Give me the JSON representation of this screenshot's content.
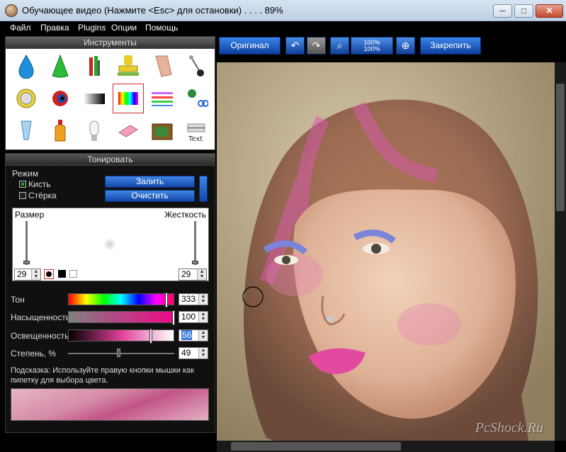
{
  "window": {
    "title": "Обучающее видео (Нажмите <Esc> для остановки) . . . . 89%",
    "min": "─",
    "max": "□",
    "close": "✕"
  },
  "menu": [
    "Файл",
    "Правка",
    "Plugins",
    "Опции",
    "Помощь"
  ],
  "tools": {
    "header": "Инструменты",
    "icons": [
      "water-drop",
      "green-cone",
      "paint-tubes",
      "stamp",
      "eraser-finger",
      "pin",
      "jewel",
      "eye",
      "gradient",
      "rainbow",
      "color-lines",
      "scissors-clone",
      "tube",
      "bottle",
      "bulb",
      "eraser",
      "tv",
      "text-stack"
    ],
    "selected_index": 9
  },
  "tone": {
    "header": "Тонировать",
    "mode_label": "Режим",
    "brush_label": "Кисть",
    "erase_label": "Стёрка",
    "fill_button": "Залить",
    "clear_button": "Очистить",
    "size_label": "Размер",
    "hardness_label": "Жесткость",
    "size_value": "29",
    "hardness_value": "29",
    "hue_label": "Тон",
    "hue_value": "333",
    "sat_label": "Насыщенность",
    "sat_value": "100",
    "light_label": "Освещенность",
    "light_value": "56",
    "degree_label": "Степень, %",
    "degree_value": "49",
    "hint": "Подсказка: Используйте правую кнопки мышки как пипетку для выбора цвета."
  },
  "toolbar": {
    "original_button": "Оригинал",
    "zoom_text": "100%\n100%",
    "pin_button": "Закрепить"
  },
  "watermark": "PcShock.Ru",
  "colors": {
    "accent": "#1b5fd0",
    "selected_border": "#d0262a",
    "tint": "#e0409a"
  }
}
